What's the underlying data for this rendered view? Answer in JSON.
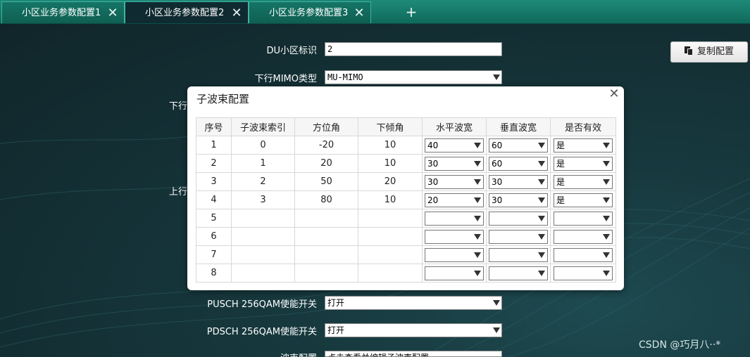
{
  "tabs": [
    {
      "label": "小区业务参数配置1",
      "close": "✕"
    },
    {
      "label": "小区业务参数配置2",
      "close": "✕"
    },
    {
      "label": "小区业务参数配置3",
      "close": "✕"
    }
  ],
  "tab_add": "+",
  "form": {
    "du_label": "DU小区标识",
    "du_value": "2",
    "dl_mimo_label": "下行MIMO类型",
    "dl_mimo_value": "MU-MIMO",
    "partial_label_1": "下行",
    "partial_label_2": "上行",
    "pusch_label": "PUSCH 256QAM使能开关",
    "pusch_value": "打开",
    "pdsch_label": "PDSCH 256QAM使能开关",
    "pdsch_value": "打开",
    "beam_label": "波束配置",
    "beam_value": "点击查看并编辑子波束配置"
  },
  "copy_button": "复制配置",
  "modal": {
    "title": "子波束配置",
    "close": "✕",
    "headers": [
      "序号",
      "子波束索引",
      "方位角",
      "下倾角",
      "水平波宽",
      "垂直波宽",
      "是否有效"
    ],
    "rows": [
      {
        "no": "1",
        "index": "0",
        "azimuth": "-20",
        "tilt": "10",
        "h_width": "40",
        "v_width": "60",
        "valid": "是"
      },
      {
        "no": "2",
        "index": "1",
        "azimuth": "20",
        "tilt": "10",
        "h_width": "30",
        "v_width": "60",
        "valid": "是"
      },
      {
        "no": "3",
        "index": "2",
        "azimuth": "50",
        "tilt": "20",
        "h_width": "30",
        "v_width": "30",
        "valid": "是"
      },
      {
        "no": "4",
        "index": "3",
        "azimuth": "80",
        "tilt": "10",
        "h_width": "20",
        "v_width": "30",
        "valid": "是"
      },
      {
        "no": "5",
        "index": "",
        "azimuth": "",
        "tilt": "",
        "h_width": "",
        "v_width": "",
        "valid": ""
      },
      {
        "no": "6",
        "index": "",
        "azimuth": "",
        "tilt": "",
        "h_width": "",
        "v_width": "",
        "valid": ""
      },
      {
        "no": "7",
        "index": "",
        "azimuth": "",
        "tilt": "",
        "h_width": "",
        "v_width": "",
        "valid": ""
      },
      {
        "no": "8",
        "index": "",
        "azimuth": "",
        "tilt": "",
        "h_width": "",
        "v_width": "",
        "valid": ""
      }
    ]
  },
  "watermark": "CSDN @巧月八··*"
}
